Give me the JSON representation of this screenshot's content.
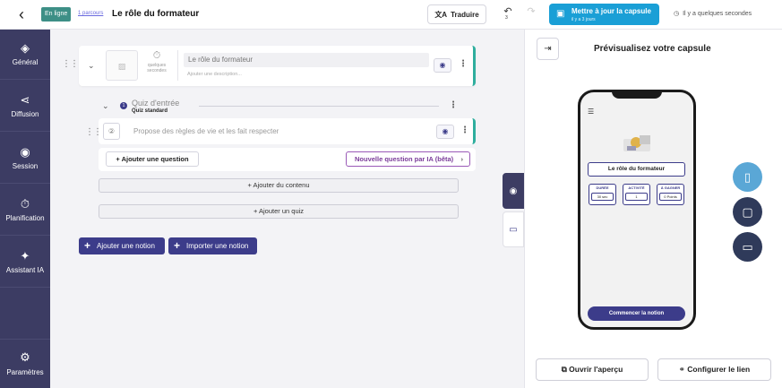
{
  "header": {
    "status": "En ligne",
    "parcours_link": "1 parcours",
    "title": "Le rôle du formateur",
    "translate_label": "Traduire",
    "undo_count": "3",
    "update_label": "Mettre à jour la capsule",
    "update_sub": "il y a 3 jours",
    "saved_info": "Il y a quelques secondes"
  },
  "sidebar": {
    "items": [
      {
        "label": "Général",
        "icon": "pill-icon"
      },
      {
        "label": "Diffusion",
        "icon": "share-icon"
      },
      {
        "label": "Session",
        "icon": "target-icon"
      },
      {
        "label": "Planification",
        "icon": "timer-icon"
      },
      {
        "label": "Assistant IA",
        "icon": "sparkle-icon"
      }
    ],
    "settings_label": "Paramètres"
  },
  "chapter": {
    "duration_label": "quelques secondes",
    "title_placeholder": "Le rôle du formateur",
    "description_placeholder": "Ajouter une description..."
  },
  "quiz": {
    "badge": "1",
    "title": "Quiz d'entrée",
    "subtitle": "Quiz standard",
    "question": "Propose des règles de vie et les fait respecter",
    "add_question": "Ajouter une question",
    "ai_question": "Nouvelle question par IA (bêta)"
  },
  "actions": {
    "add_content": "Ajouter du contenu",
    "add_quiz": "Ajouter un quiz",
    "add_notion": "Ajouter une notion",
    "import_notion": "Importer une notion"
  },
  "preview": {
    "title": "Prévisualisez votre capsule",
    "capsule_title": "Le rôle du formateur",
    "stats": [
      {
        "label": "DURÉE",
        "value": "30 sec"
      },
      {
        "label": "ACTIVITÉ",
        "value": "1"
      },
      {
        "label": "À GAGNER",
        "value": "0 Points"
      }
    ],
    "start_label": "Commencer la notion",
    "open_preview": "Ouvrir l'aperçu",
    "configure_link": "Configurer le lien"
  },
  "colors": {
    "sidebar": "#3c3c63",
    "primary": "#3c3c8a",
    "accent_teal": "#2fae9e",
    "update_blue": "#1a9fd6",
    "ai_purple": "#7b3c9a"
  }
}
